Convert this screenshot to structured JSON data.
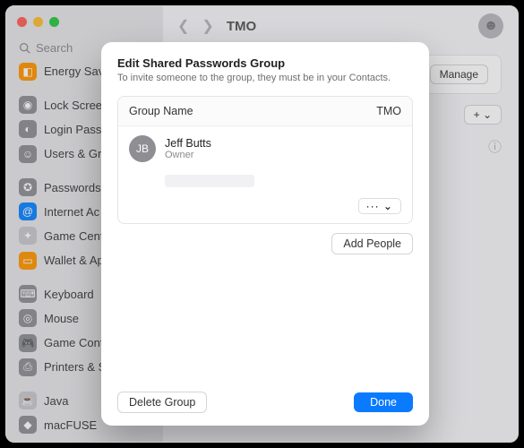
{
  "window": {
    "search_placeholder": "Search",
    "breadcrumb": "TMO"
  },
  "sidebar": {
    "items": [
      {
        "label": "Energy Sav"
      },
      {
        "label": "Lock Screen"
      },
      {
        "label": "Login Pass"
      },
      {
        "label": "Users & Gr"
      },
      {
        "label": "Passwords"
      },
      {
        "label": "Internet Ac"
      },
      {
        "label": "Game Cent"
      },
      {
        "label": "Wallet & Ap"
      },
      {
        "label": "Keyboard"
      },
      {
        "label": "Mouse"
      },
      {
        "label": "Game Cont"
      },
      {
        "label": "Printers & S"
      },
      {
        "label": "Java"
      },
      {
        "label": "macFUSE"
      }
    ]
  },
  "main": {
    "manage_label": "Manage",
    "add_label": "+"
  },
  "sheet": {
    "title": "Edit Shared Passwords Group",
    "subtitle": "To invite someone to the group, they must be in your Contacts.",
    "group_name_label": "Group Name",
    "group_name_value": "TMO",
    "member": {
      "initials": "JB",
      "name": "Jeff Butts",
      "role": "Owner"
    },
    "more_glyph": "··· ⌄",
    "add_people_label": "Add People",
    "delete_label": "Delete Group",
    "done_label": "Done"
  }
}
